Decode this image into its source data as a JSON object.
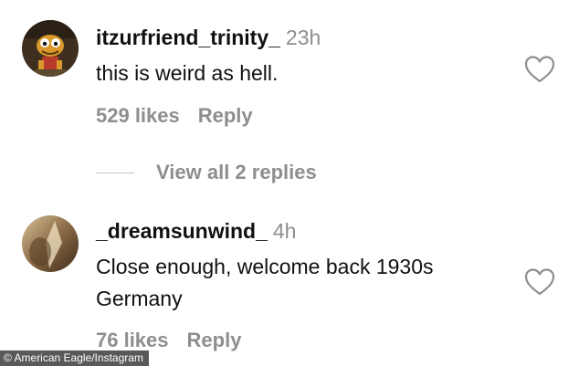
{
  "comments": [
    {
      "username": "itzurfriend_trinity_",
      "time": "23h",
      "text": "this is weird as hell.",
      "likes": "529 likes",
      "reply": "Reply",
      "avatar_icon": "cartoon-character-avatar"
    },
    {
      "username": "_dreamsunwind_",
      "time": "4h",
      "text": "Close enough, welcome back 1930s Germany",
      "likes": "76 likes",
      "reply": "Reply",
      "avatar_icon": "blurred-photo-avatar"
    }
  ],
  "view_replies": "View all 2 replies",
  "credit": "American Eagle/Instagram",
  "icons": {
    "like": "heart-outline-icon"
  },
  "colors": {
    "text": "#111111",
    "secondary": "#8e8e8e",
    "background": "#ffffff"
  }
}
